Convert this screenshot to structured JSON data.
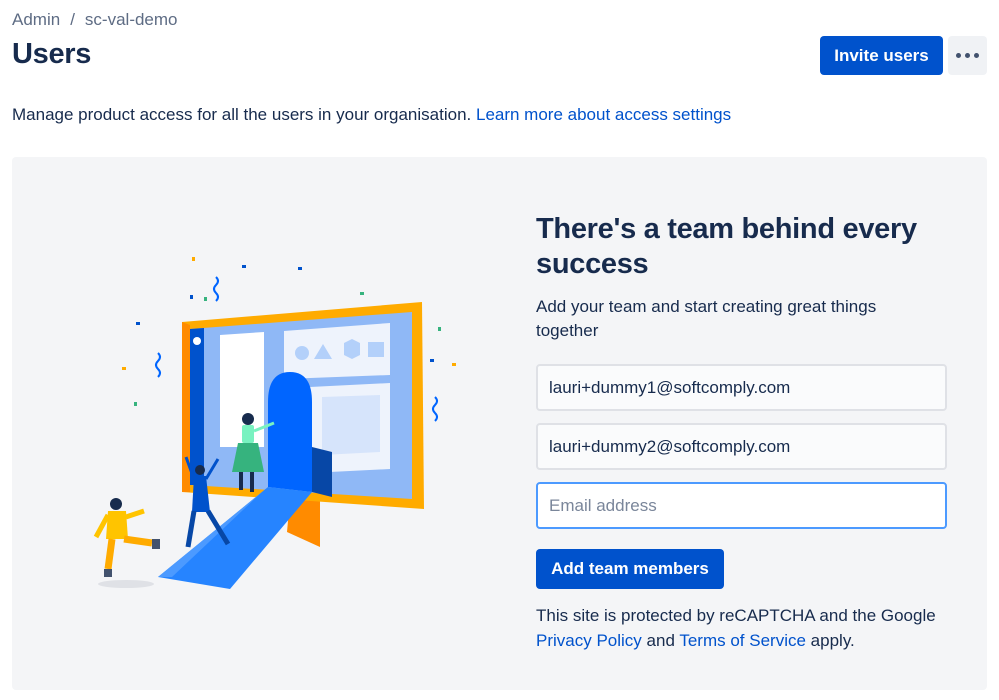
{
  "breadcrumb": {
    "items": [
      "Admin",
      "sc-val-demo"
    ],
    "separator": "/"
  },
  "page": {
    "title": "Users"
  },
  "header": {
    "invite_label": "Invite users",
    "more_icon": "more-horizontal-icon"
  },
  "intro": {
    "text": "Manage product access for all the users in your organisation.",
    "link": "Learn more about access settings"
  },
  "panel": {
    "heading": "There's a team behind every success",
    "subtext": "Add your team and start creating great things together",
    "emails": [
      "lauri+dummy1@softcomply.com",
      "lauri+dummy2@softcomply.com"
    ],
    "email_placeholder": "Email address",
    "add_label": "Add team members",
    "captcha": {
      "prefix": "This site is protected by reCAPTCHA and the Google",
      "privacy_link": "Privacy Policy",
      "and": "and",
      "terms_link": "Terms of Service",
      "suffix": "apply."
    }
  },
  "colors": {
    "primary": "#0052cc",
    "text": "#172b4d",
    "panel_bg": "#f4f5f7",
    "focus": "#4c9aff"
  }
}
